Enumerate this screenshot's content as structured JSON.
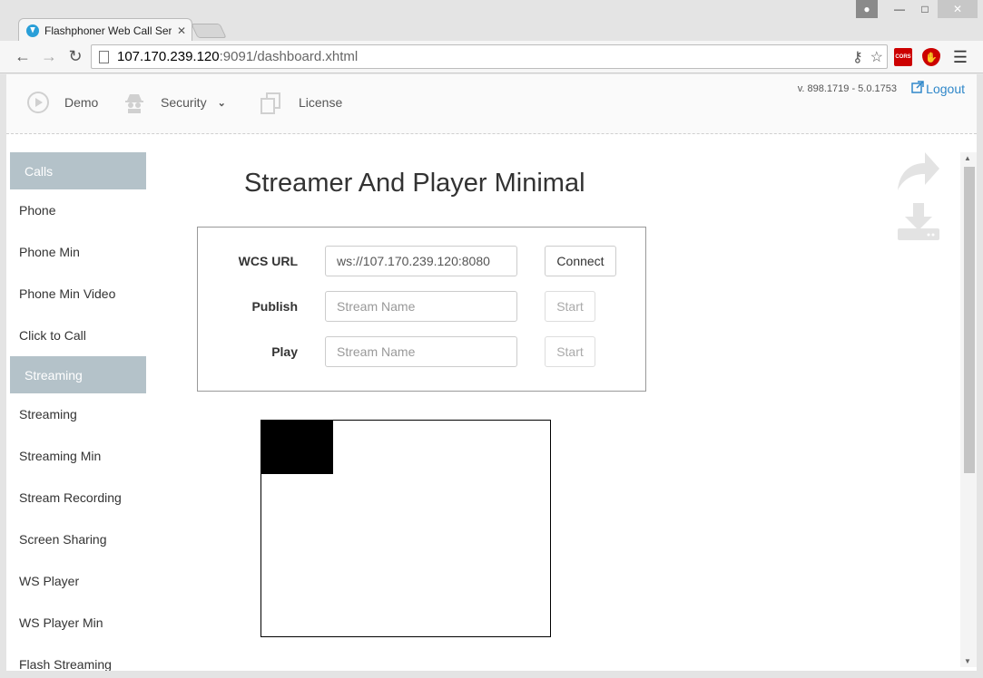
{
  "browser": {
    "tab_title": "Flashphoner Web Call Ser",
    "url_host": "107.170.239.120",
    "url_rest": ":9091/dashboard.xhtml",
    "extensions": {
      "cors_label": "CORS"
    }
  },
  "topnav": {
    "items": [
      {
        "label": "Demo"
      },
      {
        "label": "Security"
      },
      {
        "label": "License"
      }
    ],
    "version": "v. 898.1719 - 5.0.1753",
    "logout": "Logout"
  },
  "sidebar": {
    "sections": [
      {
        "header": "Calls",
        "items": [
          "Phone",
          "Phone Min",
          "Phone Min Video",
          "Click to Call"
        ]
      },
      {
        "header": "Streaming",
        "items": [
          "Streaming",
          "Streaming Min",
          "Stream Recording",
          "Screen Sharing",
          "WS Player",
          "WS Player Min",
          "Flash Streaming"
        ]
      }
    ]
  },
  "main": {
    "title": "Streamer And Player Minimal",
    "form": {
      "wcs_url_label": "WCS URL",
      "wcs_url_value": "ws://107.170.239.120:8080",
      "connect_label": "Connect",
      "publish_label": "Publish",
      "publish_placeholder": "Stream Name",
      "publish_start": "Start",
      "play_label": "Play",
      "play_placeholder": "Stream Name",
      "play_start": "Start"
    }
  }
}
